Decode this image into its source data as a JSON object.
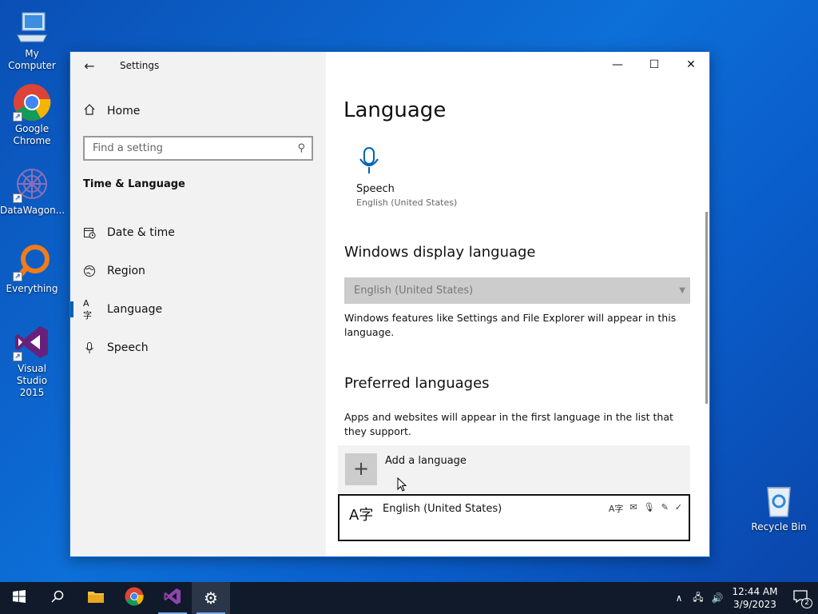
{
  "desktop": {
    "icons": [
      {
        "label": "My Computer"
      },
      {
        "label": "Google Chrome"
      },
      {
        "label": "DataWagon..."
      },
      {
        "label": "Everything"
      },
      {
        "label": "Visual Studio 2015"
      },
      {
        "label": "Recycle Bin"
      }
    ]
  },
  "window": {
    "app_title": "Settings",
    "controls": {
      "minimize": "—",
      "maximize": "☐",
      "close": "✕"
    }
  },
  "nav": {
    "home_label": "Home",
    "search_placeholder": "Find a setting",
    "section_title": "Time & Language",
    "items": [
      {
        "label": "Date & time"
      },
      {
        "label": "Region"
      },
      {
        "label": "Language",
        "selected": true
      },
      {
        "label": "Speech"
      }
    ]
  },
  "content": {
    "page_title": "Language",
    "speech_tile": {
      "label": "Speech",
      "sub": "English (United States)"
    },
    "display_language": {
      "heading": "Windows display language",
      "selected": "English (United States)",
      "description": "Windows features like Settings and File Explorer will appear in this language."
    },
    "preferred": {
      "heading": "Preferred languages",
      "description": "Apps and websites will appear in the first language in the list that they support.",
      "add_label": "Add a language",
      "languages": [
        {
          "name": "English (United States)"
        }
      ]
    }
  },
  "taskbar": {
    "time": "12:44 AM",
    "date": "3/9/2023",
    "notification_count": "2"
  }
}
